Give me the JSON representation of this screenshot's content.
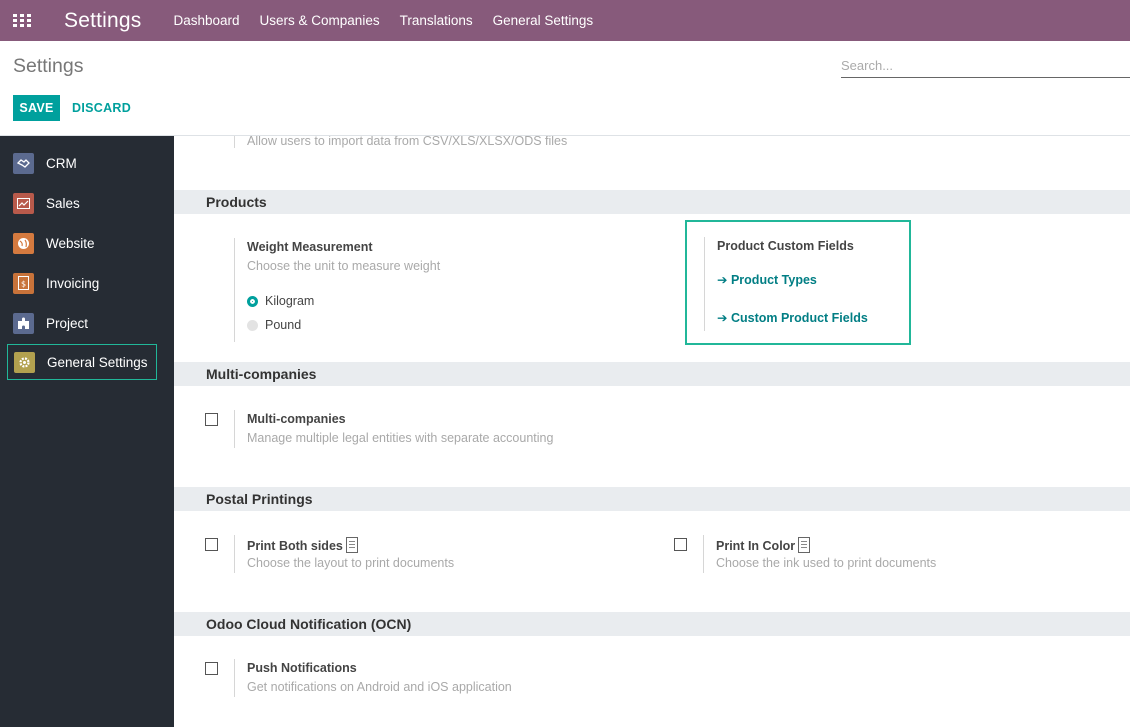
{
  "navbar": {
    "title": "Settings",
    "menu": [
      "Dashboard",
      "Users & Companies",
      "Translations",
      "General Settings"
    ],
    "color": "#875a7b"
  },
  "control_panel": {
    "breadcrumb": "Settings",
    "search_placeholder": "Search...",
    "save_label": "SAVE",
    "discard_label": "DISCARD",
    "accent": "#00a09d"
  },
  "sidebar": {
    "items": [
      {
        "label": "CRM",
        "icon": "handshake-icon",
        "color": "#5b6a8f"
      },
      {
        "label": "Sales",
        "icon": "chart-icon",
        "color": "#b85a4b"
      },
      {
        "label": "Website",
        "icon": "globe-icon",
        "color": "#d47a3f"
      },
      {
        "label": "Invoicing",
        "icon": "invoice-icon",
        "color": "#c8733a"
      },
      {
        "label": "Project",
        "icon": "puzzle-icon",
        "color": "#5b6a8f"
      },
      {
        "label": "General Settings",
        "icon": "gear-icon",
        "color": "#b2a14f",
        "active": true
      }
    ]
  },
  "main": {
    "import_desc": "Allow users to import data from CSV/XLS/XLSX/ODS files",
    "products": {
      "header": "Products",
      "weight": {
        "title": "Weight Measurement",
        "desc": "Choose the unit to measure weight",
        "options": [
          {
            "label": "Kilogram",
            "selected": true
          },
          {
            "label": "Pound",
            "selected": false
          }
        ]
      },
      "custom_fields": {
        "title": "Product Custom Fields",
        "links": [
          "Product Types",
          "Custom Product Fields"
        ]
      }
    },
    "multi_companies": {
      "header": "Multi-companies",
      "title": "Multi-companies",
      "desc": "Manage multiple legal entities with separate accounting"
    },
    "postal": {
      "header": "Postal Printings",
      "both_sides": {
        "title": "Print Both sides",
        "desc": "Choose the layout to print documents"
      },
      "in_color": {
        "title": "Print In Color",
        "desc": "Choose the ink used to print documents"
      }
    },
    "ocn": {
      "header": "Odoo Cloud Notification (OCN)",
      "title": "Push Notifications",
      "desc": "Get notifications on Android and iOS application"
    }
  }
}
